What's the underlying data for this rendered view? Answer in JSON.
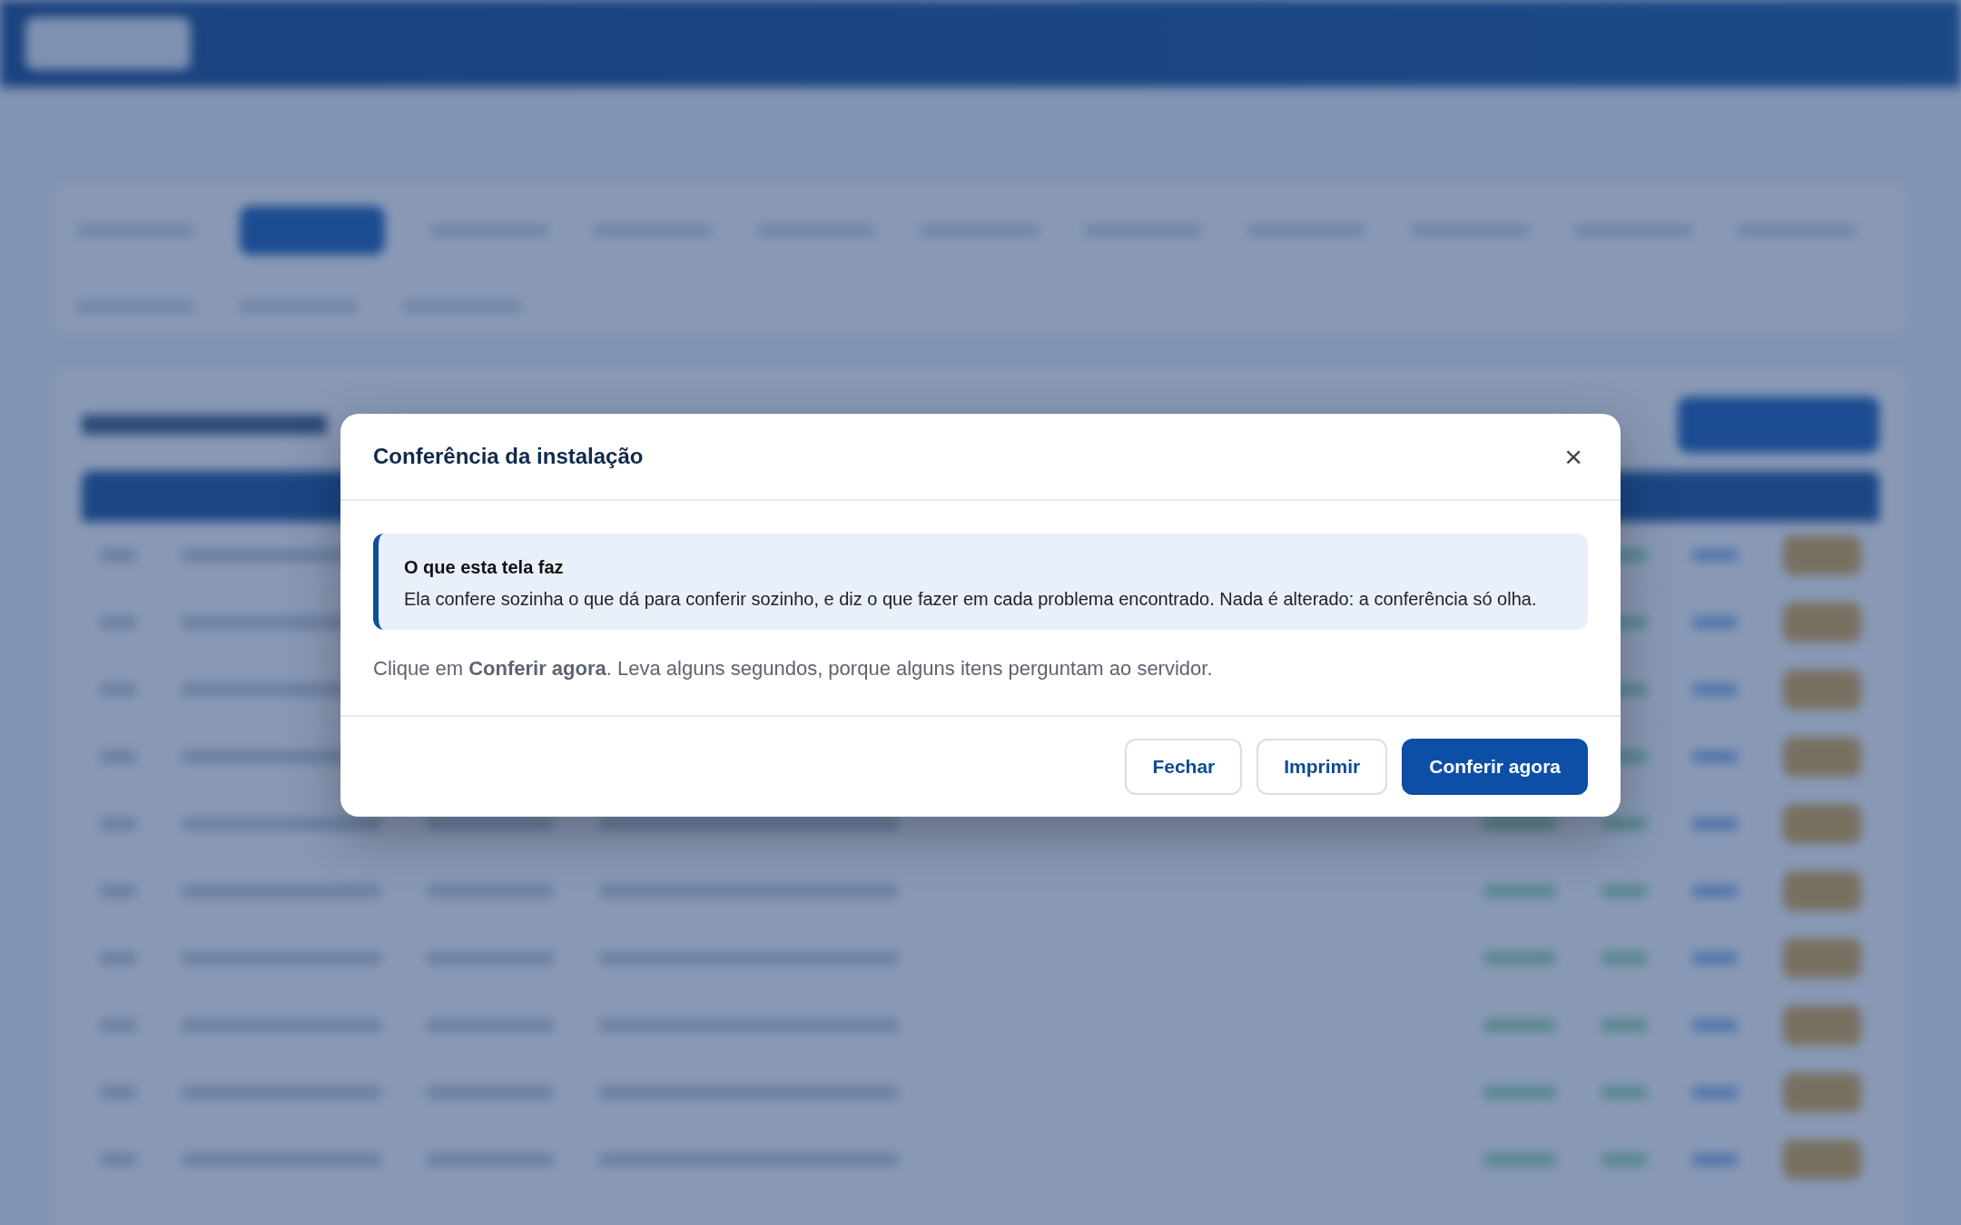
{
  "dialog": {
    "title": "Conferência da instalação",
    "close": "×",
    "notice": {
      "title": "O que esta tela faz",
      "text": "Ela confere sozinha o que dá para conferir sozinho, e diz o que fazer em cada problema encontrado. Nada é alterado: a conferência só olha."
    },
    "instruction": "Clique em **Conferir agora**. Leva alguns segundos, porque alguns itens perguntam ao servidor.",
    "buttons": [
      {
        "label": "Fechar",
        "kind": "secondary"
      },
      {
        "label": "Imprimir",
        "kind": "secondary"
      },
      {
        "label": "Conferir agora",
        "kind": "primary"
      }
    ]
  }
}
